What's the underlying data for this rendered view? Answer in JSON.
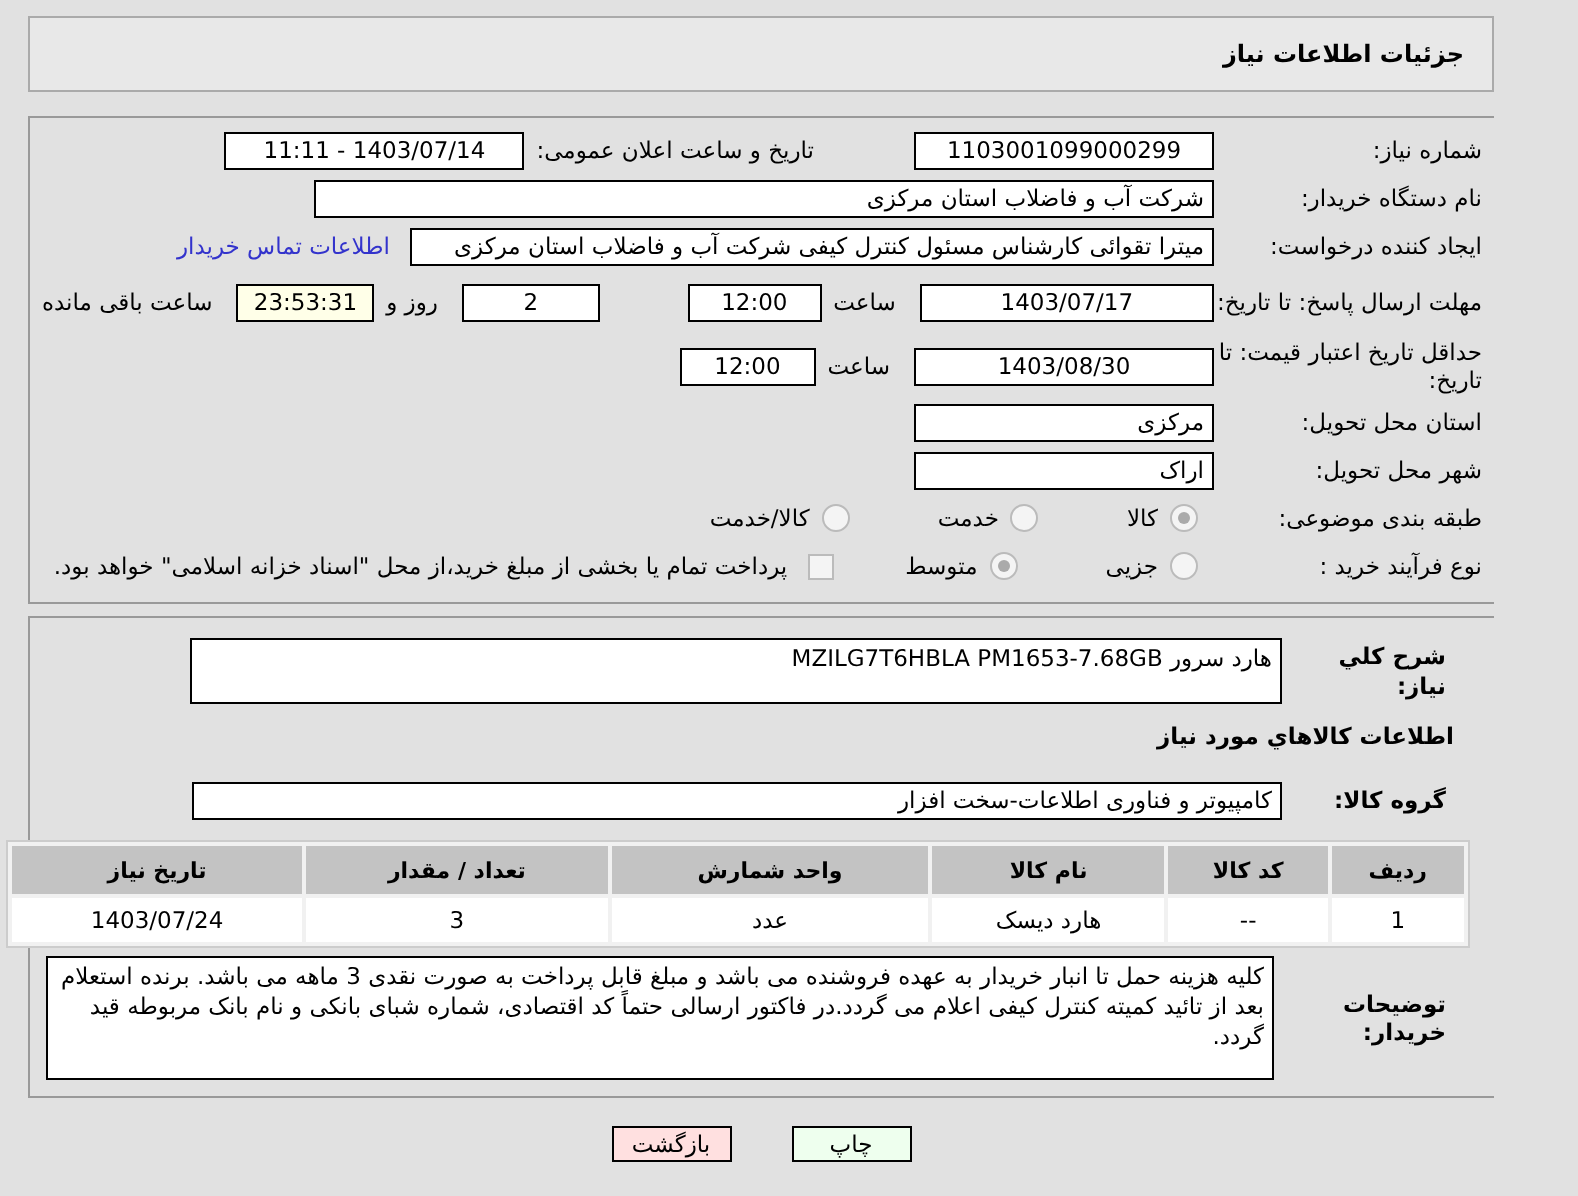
{
  "header": {
    "title": "جزئیات اطلاعات نیاز"
  },
  "need_number": {
    "label": "شماره نیاز:",
    "value": "1103001099000299"
  },
  "announce": {
    "label": "تاریخ و ساعت اعلان عمومی:",
    "value": "1403/07/14 - 11:11"
  },
  "buyer": {
    "label": "نام دستگاه خریدار:",
    "value": "شرکت آب و فاضلاب استان مرکزی"
  },
  "creator": {
    "label": "ایجاد کننده درخواست:",
    "value": "میترا تقوائی کارشناس مسئول کنترل کیفی شرکت آب و فاضلاب استان مرکزی",
    "link": "اطلاعات تماس خریدار"
  },
  "deadline": {
    "label": "مهلت ارسال پاسخ: تا تاریخ:",
    "date": "1403/07/17",
    "time_label": "ساعت",
    "time": "12:00",
    "days": "2",
    "days_label": "روز و",
    "remaining": "23:53:31",
    "remaining_label": "ساعت باقی مانده"
  },
  "validity": {
    "label": "حداقل تاریخ اعتبار قیمت: تا تاریخ:",
    "date": "1403/08/30",
    "time_label": "ساعت",
    "time": "12:00"
  },
  "province": {
    "label": "استان محل تحویل:",
    "value": "مرکزی"
  },
  "city": {
    "label": "شهر محل تحویل:",
    "value": "اراک"
  },
  "category": {
    "label": "طبقه بندی موضوعی:",
    "options": [
      {
        "label": "کالا",
        "selected": true
      },
      {
        "label": "خدمت",
        "selected": false
      },
      {
        "label": "کالا/خدمت",
        "selected": false
      }
    ]
  },
  "process": {
    "label": "نوع فرآیند خرید :",
    "options": [
      {
        "label": "جزیی",
        "selected": false
      },
      {
        "label": "متوسط",
        "selected": true
      }
    ],
    "treasury": {
      "label": "پرداخت تمام یا بخشی از مبلغ خرید،از محل \"اسناد خزانه اسلامی\" خواهد بود.",
      "checked": false
    }
  },
  "summary": {
    "label": "شرح کلي نياز:",
    "value": "هارد سرور MZILG7T6HBLA PM1653-7.68GB"
  },
  "goods_heading": "اطلاعات کالاهاي مورد نياز",
  "goods_group": {
    "label": "گروه کالا:",
    "value": "کامپیوتر و فناوری اطلاعات-سخت افزار"
  },
  "table": {
    "columns": [
      "ردیف",
      "کد کالا",
      "نام کالا",
      "واحد شمارش",
      "تعداد / مقدار",
      "تاریخ نیاز"
    ],
    "rows": [
      [
        "1",
        "--",
        "هارد دیسک",
        "عدد",
        "3",
        "1403/07/24"
      ]
    ]
  },
  "notes": {
    "label": "توضیحات خریدار:",
    "value": "کلیه هزینه حمل تا انبار خریدار به عهده فروشنده می باشد و مبلغ قابل پرداخت به صورت نقدی 3 ماهه می باشد. برنده استعلام بعد از تائید کمیته کنترل کیفی اعلام می گردد.در فاکتور ارسالی حتماً کد اقتصادی، شماره شبای بانکی و نام بانک مربوطه قید گردد."
  },
  "buttons": [
    {
      "label": "چاپ",
      "kind": "print"
    },
    {
      "label": "بازگشت",
      "kind": "back"
    }
  ]
}
